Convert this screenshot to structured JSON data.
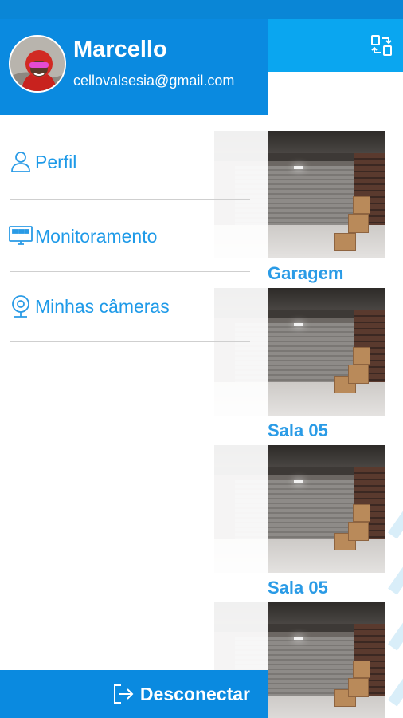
{
  "user": {
    "name": "Marcello",
    "email": "cellovalsesia@gmail.com"
  },
  "menu": [
    {
      "label": "Perfil",
      "icon": "user-icon"
    },
    {
      "label": "Monitoramento",
      "icon": "monitor-icon"
    },
    {
      "label": "Minhas câmeras",
      "icon": "webcam-icon"
    }
  ],
  "logout": {
    "label": "Desconectar",
    "icon": "logout-icon"
  },
  "cameras": [
    {
      "name": "Garagem"
    },
    {
      "name": "Sala 05"
    },
    {
      "name": "Sala 05"
    },
    {
      "name": ""
    }
  ],
  "header": {
    "switch_icon": "switch-camera-icon"
  },
  "colors": {
    "drawer_header": "#0a8ae0",
    "app_header": "#0aa6f0",
    "accent_text": "#1e9ae8",
    "status_bar": "#0a86d6"
  }
}
